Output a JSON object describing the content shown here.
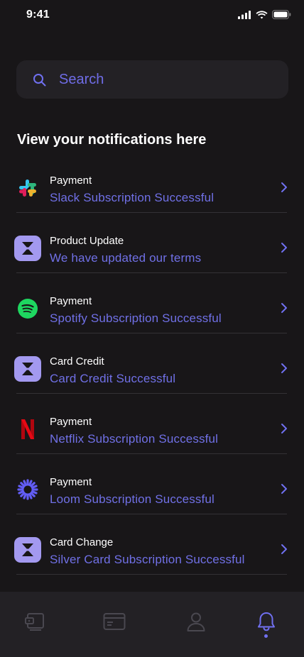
{
  "status_bar": {
    "time": "9:41"
  },
  "search": {
    "placeholder": "Search",
    "value": ""
  },
  "section_title": "View your notifications here",
  "notifications": [
    {
      "kind": "Payment",
      "message": "Slack Subscription Successful",
      "icon": "slack-logo-icon"
    },
    {
      "kind": "Product Update",
      "message": "We have updated our terms",
      "icon": "app-logo-icon"
    },
    {
      "kind": "Payment",
      "message": "Spotify Subscription Successful",
      "icon": "spotify-logo-icon"
    },
    {
      "kind": "Card Credit",
      "message": "Card Credit Successful",
      "icon": "app-logo-icon"
    },
    {
      "kind": "Payment",
      "message": "Netflix Subscription Successful",
      "icon": "netflix-logo-icon"
    },
    {
      "kind": "Payment",
      "message": "Loom Subscription Successful",
      "icon": "loom-logo-icon"
    },
    {
      "kind": "Card Change",
      "message": "Silver Card Subscription Successful",
      "icon": "app-logo-icon"
    }
  ],
  "tabbar": {
    "tabs": [
      {
        "icon": "wallet-icon",
        "active": false
      },
      {
        "icon": "card-icon",
        "active": false
      },
      {
        "icon": "profile-icon",
        "active": false
      },
      {
        "icon": "bell-icon",
        "active": true
      }
    ]
  },
  "colors": {
    "background": "#181618",
    "surface": "#232125",
    "accent": "#7070e6",
    "app_logo": "#a399f0"
  }
}
